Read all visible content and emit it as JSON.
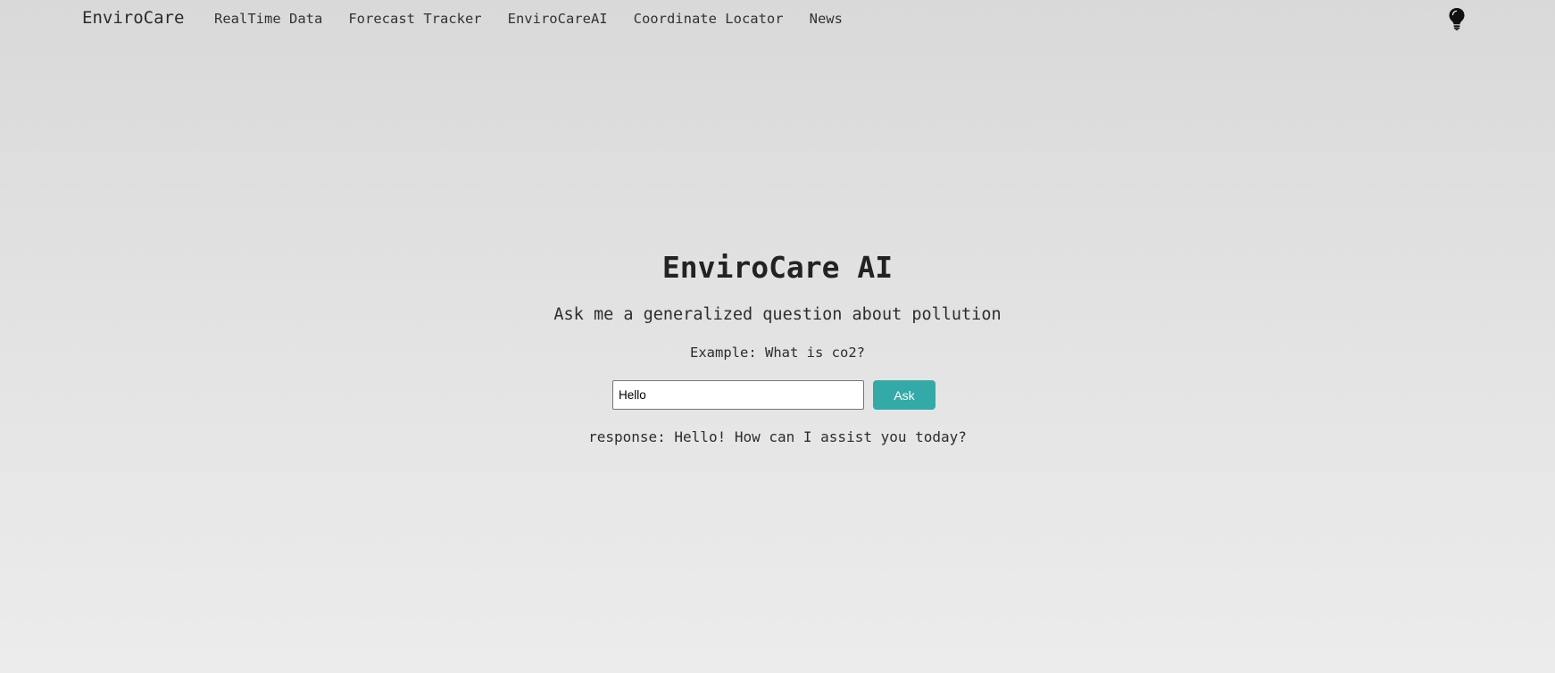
{
  "navbar": {
    "brand": "EnviroCare",
    "links": [
      {
        "label": "RealTime Data"
      },
      {
        "label": "Forecast Tracker"
      },
      {
        "label": "EnviroCareAI"
      },
      {
        "label": "Coordinate Locator"
      },
      {
        "label": "News"
      }
    ],
    "theme_toggle_icon": "lightbulb-icon"
  },
  "main": {
    "title": "EnviroCare AI",
    "subtitle": "Ask me a generalized question about pollution",
    "example": "Example: What is co2?",
    "input_value": "Hello",
    "ask_label": "Ask",
    "response_prefix": "response:",
    "response_text": "Hello! How can I assist you today?"
  },
  "colors": {
    "accent": "#34aaa8",
    "background_top": "#d9d9d9",
    "background_bottom": "#ececec"
  }
}
